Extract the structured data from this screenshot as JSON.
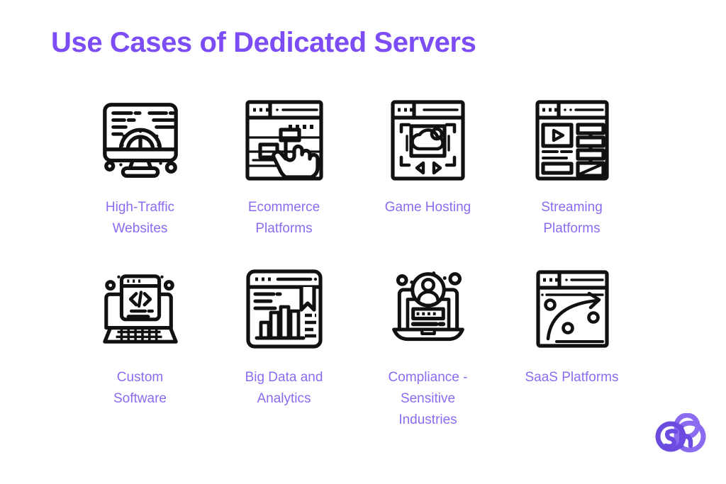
{
  "title": "Use Cases of Dedicated Servers",
  "colors": {
    "background": "#ffffff",
    "title": "#7C4DF5",
    "label": "#8B6BF0",
    "icon_stroke": "#111111",
    "logo_light": "#8B6BF0",
    "logo_dark": "#6B4BE0"
  },
  "items": [
    {
      "label": "High-Traffic\nWebsites",
      "icon": "monitor-gauge-icon"
    },
    {
      "label": "Ecommerce\nPlatforms",
      "icon": "browser-click-hand-icon"
    },
    {
      "label": "Game Hosting",
      "icon": "browser-cloud-player-icon"
    },
    {
      "label": "Streaming\nPlatforms",
      "icon": "browser-video-playlist-icon"
    },
    {
      "label": "Custom\nSoftware",
      "icon": "laptop-code-icon"
    },
    {
      "label": "Big Data and\nAnalytics",
      "icon": "browser-bar-chart-bookmark-icon"
    },
    {
      "label": "Compliance -\nSensitive\nIndustries",
      "icon": "laptop-user-profile-icon"
    },
    {
      "label": "SaaS Platforms",
      "icon": "browser-arrow-nodes-icon"
    }
  ],
  "logo": {
    "name": "sh-cloud-logo",
    "wordmark": "sh"
  }
}
